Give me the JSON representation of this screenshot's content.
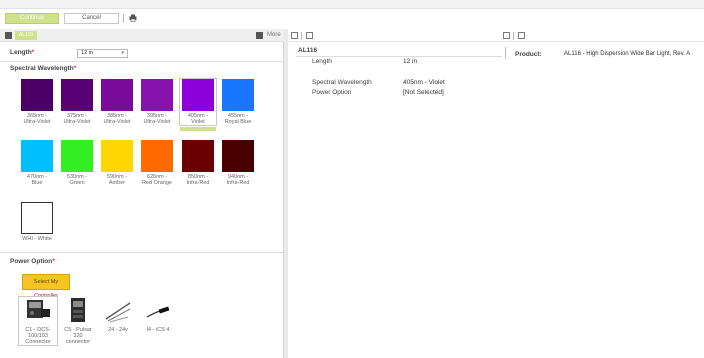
{
  "toolbar": {
    "continue_label": "Continue",
    "cancel_label": "Cancel",
    "print_icon": "print-icon"
  },
  "tabs": {
    "active_tab": "AL116",
    "more_label": "More"
  },
  "length": {
    "label": "Length",
    "value": "12 in"
  },
  "spectral": {
    "label": "Spectral Wavelength",
    "selected": "405nm - Violet",
    "options": [
      {
        "line1": "365nm -",
        "line2": "Ultra-Violet",
        "color": "#4b0066"
      },
      {
        "line1": "375nm -",
        "line2": "Ultra-Violet",
        "color": "#5a0075"
      },
      {
        "line1": "385nm -",
        "line2": "Ultra-Violet",
        "color": "#7a0a99"
      },
      {
        "line1": "395nm -",
        "line2": "Ultra-Violet",
        "color": "#8812ad"
      },
      {
        "line1": "405nm -",
        "line2": "Violet",
        "color": "#8c00d9"
      },
      {
        "line1": "455nm -",
        "line2": "Royal Blue",
        "color": "#1a75ff"
      },
      {
        "line1": "470nm -",
        "line2": "Blue",
        "color": "#00bfff"
      },
      {
        "line1": "530nm -",
        "line2": "Green",
        "color": "#33ee22"
      },
      {
        "line1": "590nm -",
        "line2": "Amber",
        "color": "#ffd600"
      },
      {
        "line1": "625nm -",
        "line2": "Red Orange",
        "color": "#ff6a00"
      },
      {
        "line1": "850nm -",
        "line2": "Infra-Red",
        "color": "#6b0000"
      },
      {
        "line1": "940nm -",
        "line2": "Infra-Red",
        "color": "#4a0000"
      },
      {
        "line1": "WHI - White",
        "line2": "",
        "color": "#ffffff"
      }
    ]
  },
  "power": {
    "label": "Power Option",
    "controller_button": "Select My Controller",
    "options": [
      {
        "line1": "C1 - DCS-",
        "line2": "100/103",
        "line3": "Connector",
        "icon": "controller-c1-icon"
      },
      {
        "line1": "C5 - Pulsar",
        "line2": "320",
        "line3": "connector",
        "icon": "controller-c5-icon"
      },
      {
        "line1": "24 - 24v",
        "line2": "",
        "line3": "",
        "icon": "flying-leads-icon"
      },
      {
        "line1": "I4 - iCS 4",
        "line2": "",
        "line3": "",
        "icon": "ics4-cable-icon"
      }
    ]
  },
  "details": {
    "title": "AL116",
    "rows": [
      {
        "key": "Length",
        "value": "12 in"
      },
      {
        "key": "Spectral Wavelength",
        "value": "405nm - Violet"
      },
      {
        "key": "Power Option",
        "value": "[Not Selected]"
      }
    ],
    "product_label": "Product:",
    "product_value": "AL116 - High Dispersion Wide Bar Light, Rev. A"
  },
  "colors": {
    "accent_green": "#cfe18a",
    "required_red": "#dd3333",
    "controller_yellow": "#f7c520"
  }
}
